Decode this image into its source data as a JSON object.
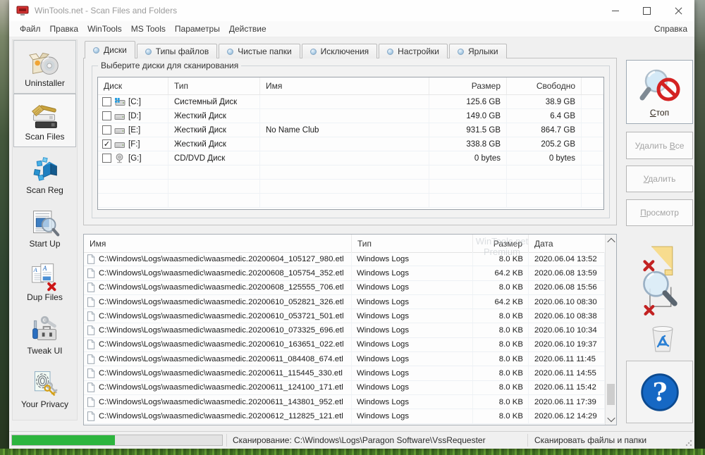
{
  "window": {
    "title": "WinTools.net - Scan Files and Folders"
  },
  "menu": {
    "items": [
      "Файл",
      "Правка",
      "WinTools",
      "MS Tools",
      "Параметры",
      "Действие"
    ],
    "help": "Справка"
  },
  "sidebar": {
    "items": [
      {
        "label": "Uninstaller",
        "icon": "uninstaller",
        "state": "boxed"
      },
      {
        "label": "Scan Files",
        "icon": "scan-files",
        "state": "active"
      },
      {
        "label": "Scan Reg",
        "icon": "scan-reg",
        "state": "normal"
      },
      {
        "label": "Start Up",
        "icon": "startup",
        "state": "normal"
      },
      {
        "label": "Dup Files",
        "icon": "dup-files",
        "state": "normal"
      },
      {
        "label": "Tweak UI",
        "icon": "tweak-ui",
        "state": "normal"
      },
      {
        "label": "Your Privacy",
        "icon": "privacy",
        "state": "normal"
      }
    ]
  },
  "tabs": {
    "active_index": 0,
    "items": [
      "Диски",
      "Типы файлов",
      "Чистые папки",
      "Исключения",
      "Настройки",
      "Ярлыки"
    ]
  },
  "scan_tab": {
    "group_title": "Выберите диски для сканирования"
  },
  "disk_table": {
    "columns": [
      "Диск",
      "Тип",
      "Имя",
      "Размер",
      "Свободно"
    ],
    "rows": [
      {
        "checked": false,
        "icon": "drive-sys",
        "drive": "[C:]",
        "type": "Системный Диск",
        "name": "",
        "size": "125.6 GB",
        "free": "38.9 GB"
      },
      {
        "checked": false,
        "icon": "drive-hdd",
        "drive": "[D:]",
        "type": "Жесткий Диск",
        "name": "",
        "size": "149.0 GB",
        "free": "6.4 GB"
      },
      {
        "checked": false,
        "icon": "drive-hdd",
        "drive": "[E:]",
        "type": "Жесткий Диск",
        "name": "No Name Club",
        "size": "931.5 GB",
        "free": "864.7 GB"
      },
      {
        "checked": true,
        "icon": "drive-hdd",
        "drive": "[F:]",
        "type": "Жесткий Диск",
        "name": "",
        "size": "338.8 GB",
        "free": "205.2 GB"
      },
      {
        "checked": false,
        "icon": "drive-cd",
        "drive": "[G:]",
        "type": "CD/DVD Диск",
        "name": "",
        "size": "0 bytes",
        "free": "0 bytes"
      }
    ]
  },
  "file_table": {
    "columns": [
      "Имя",
      "Тип",
      "Размер",
      "Дата"
    ],
    "rows": [
      {
        "name": "C:\\Windows\\Logs\\waasmedic\\waasmedic.20200604_105127_980.etl",
        "type": "Windows Logs",
        "size": "8.0 KB",
        "date": "2020.06.04 13:52"
      },
      {
        "name": "C:\\Windows\\Logs\\waasmedic\\waasmedic.20200608_105754_352.etl",
        "type": "Windows Logs",
        "size": "64.2 KB",
        "date": "2020.06.08 13:59"
      },
      {
        "name": "C:\\Windows\\Logs\\waasmedic\\waasmedic.20200608_125555_706.etl",
        "type": "Windows Logs",
        "size": "8.0 KB",
        "date": "2020.06.08 15:56"
      },
      {
        "name": "C:\\Windows\\Logs\\waasmedic\\waasmedic.20200610_052821_326.etl",
        "type": "Windows Logs",
        "size": "64.2 KB",
        "date": "2020.06.10 08:30"
      },
      {
        "name": "C:\\Windows\\Logs\\waasmedic\\waasmedic.20200610_053721_501.etl",
        "type": "Windows Logs",
        "size": "8.0 KB",
        "date": "2020.06.10 08:38"
      },
      {
        "name": "C:\\Windows\\Logs\\waasmedic\\waasmedic.20200610_073325_696.etl",
        "type": "Windows Logs",
        "size": "8.0 KB",
        "date": "2020.06.10 10:34"
      },
      {
        "name": "C:\\Windows\\Logs\\waasmedic\\waasmedic.20200610_163651_022.etl",
        "type": "Windows Logs",
        "size": "8.0 KB",
        "date": "2020.06.10 19:37"
      },
      {
        "name": "C:\\Windows\\Logs\\waasmedic\\waasmedic.20200611_084408_674.etl",
        "type": "Windows Logs",
        "size": "8.0 KB",
        "date": "2020.06.11 11:45"
      },
      {
        "name": "C:\\Windows\\Logs\\waasmedic\\waasmedic.20200611_115445_330.etl",
        "type": "Windows Logs",
        "size": "8.0 KB",
        "date": "2020.06.11 14:55"
      },
      {
        "name": "C:\\Windows\\Logs\\waasmedic\\waasmedic.20200611_124100_171.etl",
        "type": "Windows Logs",
        "size": "8.0 KB",
        "date": "2020.06.11 15:42"
      },
      {
        "name": "C:\\Windows\\Logs\\waasmedic\\waasmedic.20200611_143801_952.etl",
        "type": "Windows Logs",
        "size": "8.0 KB",
        "date": "2020.06.11 17:39"
      },
      {
        "name": "C:\\Windows\\Logs\\waasmedic\\waasmedic.20200612_112825_121.etl",
        "type": "Windows Logs",
        "size": "8.0 KB",
        "date": "2020.06.12 14:29"
      }
    ]
  },
  "actions": {
    "buttons": [
      {
        "label": "Стоп",
        "accel": 0,
        "enabled": true
      },
      {
        "label": "Удалить Все",
        "accel": 8,
        "enabled": false
      },
      {
        "label": "Удалить",
        "accel": 0,
        "enabled": false
      },
      {
        "label": "Просмотр",
        "accel": 0,
        "enabled": false
      }
    ]
  },
  "watermark": {
    "line1": "WinTools.net",
    "line2": "Premium"
  },
  "status_bar": {
    "progress_percent": 49,
    "scanning_text": "Сканирование: C:\\Windows\\Logs\\Paragon Software\\VssRequester",
    "mode_text": "Сканировать файлы и папки",
    "colors": {
      "progress_green": "#2db53e",
      "stop_red": "#d42222",
      "help_blue": "#1668c4"
    }
  }
}
